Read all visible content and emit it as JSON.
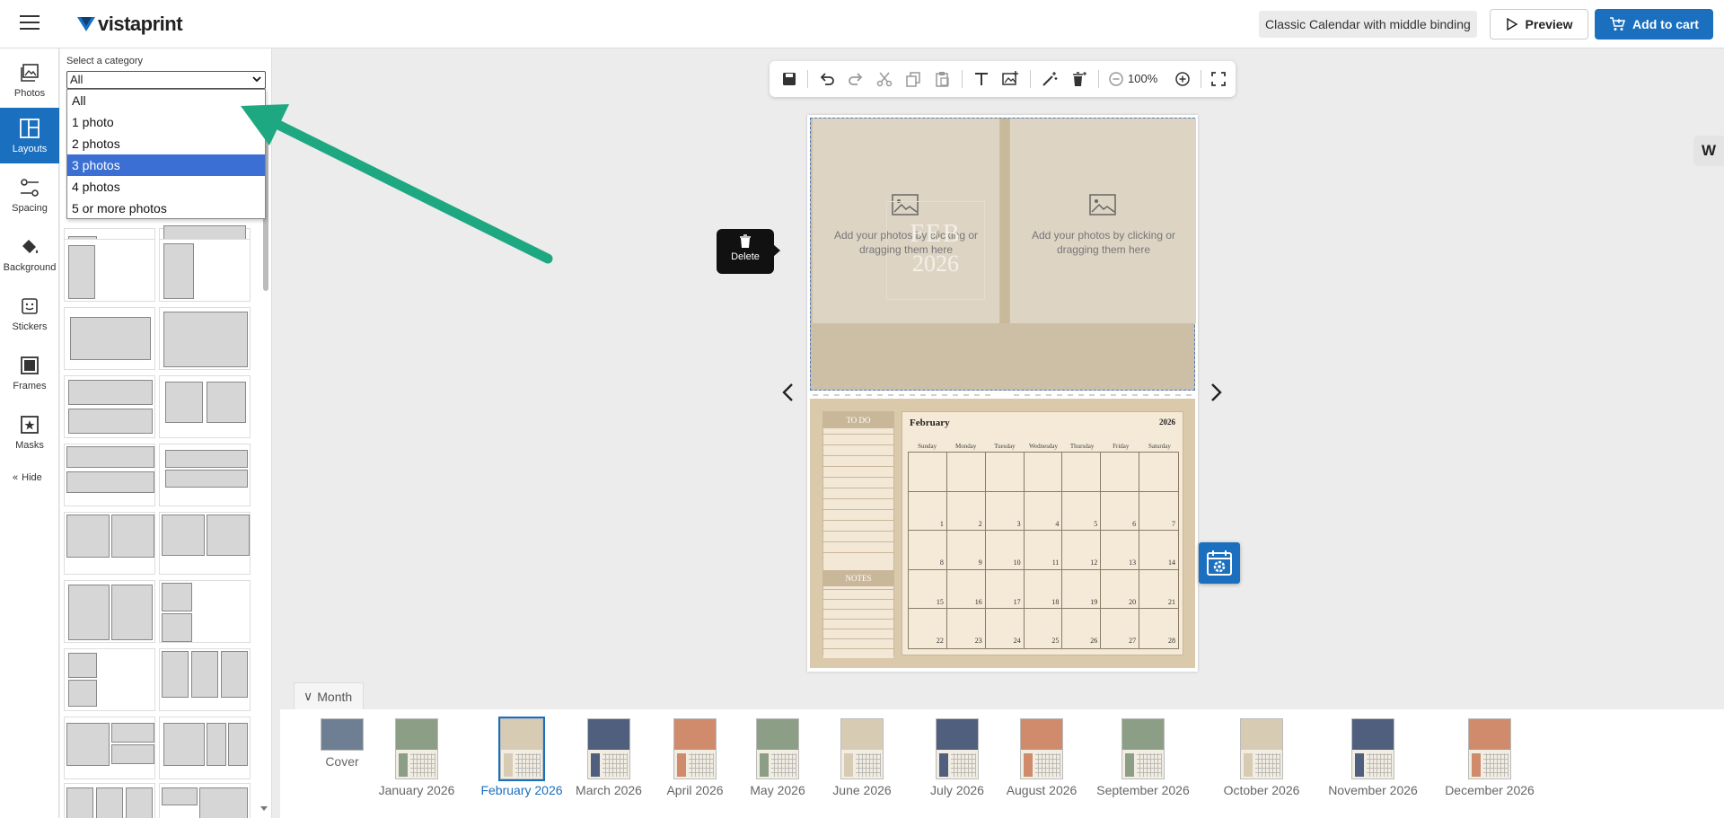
{
  "header": {
    "brand": "vistaprint",
    "product_name": "Classic Calendar with middle binding",
    "preview_label": "Preview",
    "cart_label": "Add to cart"
  },
  "rail": {
    "items": [
      {
        "label": "Photos",
        "icon": "photos-icon"
      },
      {
        "label": "Layouts",
        "icon": "layouts-icon",
        "active": true
      },
      {
        "label": "Spacing",
        "icon": "spacing-icon"
      },
      {
        "label": "Background",
        "icon": "paint-bucket-icon"
      },
      {
        "label": "Stickers",
        "icon": "sticker-icon"
      },
      {
        "label": "Frames",
        "icon": "frame-icon"
      },
      {
        "label": "Masks",
        "icon": "mask-icon"
      }
    ],
    "hide_label": "Hide"
  },
  "panel": {
    "category_label": "Select a category",
    "selected_value": "All",
    "options": [
      "All",
      "1 photo",
      "2 photos",
      "3 photos",
      "4 photos",
      "5 or more photos"
    ],
    "highlighted_option": "3 photos"
  },
  "toolbar": {
    "zoom": "100%"
  },
  "canvas": {
    "delete_label": "Delete",
    "placeholder_text": "Add your photos by clicking or dragging them here",
    "title_month": "FEB",
    "title_year": "2026",
    "todo_label": "TO DO",
    "notes_label": "NOTES",
    "calendar_month": "February",
    "calendar_year": "2026",
    "weekdays": [
      "Sunday",
      "Monday",
      "Tuesday",
      "Wednesday",
      "Thursday",
      "Friday",
      "Saturday"
    ],
    "dates": [
      "",
      "",
      "",
      "",
      "",
      "",
      "",
      "1",
      "2",
      "3",
      "4",
      "5",
      "6",
      "7",
      "8",
      "9",
      "10",
      "11",
      "12",
      "13",
      "14",
      "15",
      "16",
      "17",
      "18",
      "19",
      "20",
      "21",
      "22",
      "23",
      "24",
      "25",
      "26",
      "27",
      "28"
    ],
    "badge_letter": "W"
  },
  "months": {
    "tab_label": "Month",
    "items": [
      {
        "label": "Cover",
        "color": "#6e7f93"
      },
      {
        "label": "January 2026",
        "color": "#8c9f86"
      },
      {
        "label": "February 2026",
        "color": "#d7cbb4",
        "selected": true
      },
      {
        "label": "March 2026",
        "color": "#4f5f7d"
      },
      {
        "label": "April 2026",
        "color": "#d08a6c"
      },
      {
        "label": "May 2026",
        "color": "#8c9f86"
      },
      {
        "label": "June 2026",
        "color": "#d7cbb4"
      },
      {
        "label": "July 2026",
        "color": "#4f5f7d"
      },
      {
        "label": "August 2026",
        "color": "#d08a6c"
      },
      {
        "label": "September 2026",
        "color": "#8c9f86"
      },
      {
        "label": "October 2026",
        "color": "#d7cbb4"
      },
      {
        "label": "November 2026",
        "color": "#4f5f7d"
      },
      {
        "label": "December 2026",
        "color": "#d08a6c"
      }
    ]
  },
  "colors": {
    "accent": "#1a6fbf",
    "annotation_arrow": "#1ea882"
  }
}
